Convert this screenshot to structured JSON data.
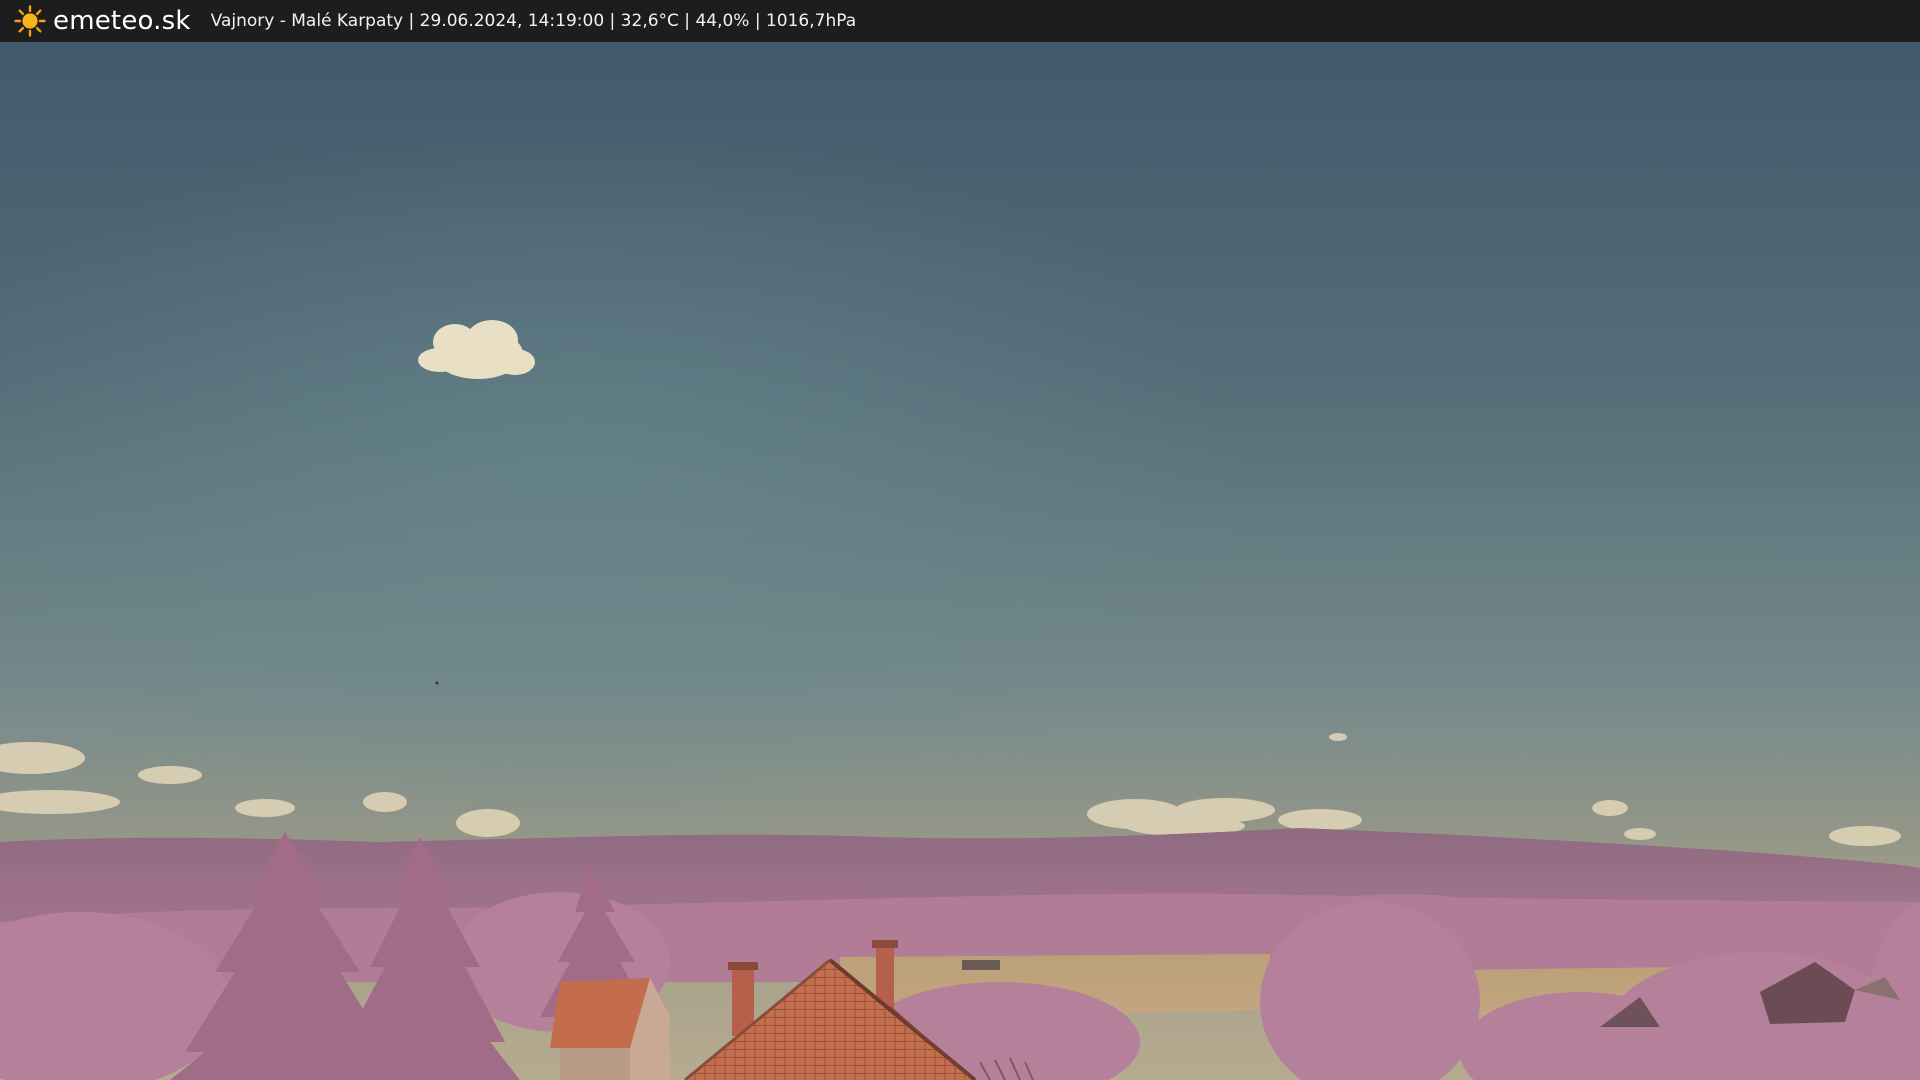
{
  "header": {
    "logo_icon": "sun-icon",
    "brand": "emeteo.sk",
    "caption": "Vajnory - Malé Karpaty | 29.06.2024, 14:19:00 | 32,6°C | 44,0% | 1016,7hPa"
  },
  "colors": {
    "bar": "#1d1d1d",
    "sky_top": "#3f5965",
    "sky_mid": "#5f7d82",
    "sky_horizon": "#b3a98d",
    "hills": "#9b6f86",
    "foliage": "#b7829d",
    "field": "#b69a78",
    "roof": "#c9704e",
    "sun": "#f4a11a"
  }
}
